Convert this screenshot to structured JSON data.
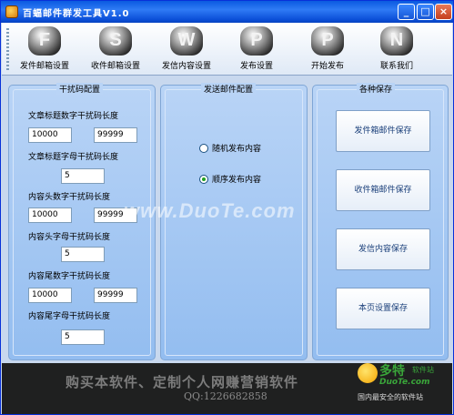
{
  "window": {
    "title": "百蝠邮件群发工具V1.0",
    "controls": {
      "minimize": "_",
      "maximize": "□",
      "close": "×"
    }
  },
  "toolbar": {
    "items": [
      {
        "label": "发件邮箱设置",
        "icon": "gear-f-icon",
        "glyph": "F"
      },
      {
        "label": "收件邮箱设置",
        "icon": "gear-s-icon",
        "glyph": "S"
      },
      {
        "label": "发信内容设置",
        "icon": "gear-w-icon",
        "glyph": "W"
      },
      {
        "label": "发布设置",
        "icon": "gear-p-icon",
        "glyph": "P"
      },
      {
        "label": "开始发布",
        "icon": "gear-p2-icon",
        "glyph": "P"
      },
      {
        "label": "联系我们",
        "icon": "gear-n-icon",
        "glyph": "N"
      }
    ]
  },
  "interference": {
    "legend": "干扰码配置",
    "article_title_num_label": "文章标题数字干扰码长度",
    "article_title_num_min": "10000",
    "article_title_num_max": "99999",
    "article_title_letter_label": "文章标题字母干扰码长度",
    "article_title_letter_value": "5",
    "content_head_num_label": "内容头数字干扰码长度",
    "content_head_num_min": "10000",
    "content_head_num_max": "99999",
    "content_head_letter_label": "内容头字母干扰码长度",
    "content_head_letter_value": "5",
    "content_tail_num_label": "内容尾数字干扰码长度",
    "content_tail_num_min": "10000",
    "content_tail_num_max": "99999",
    "content_tail_letter_label": "内容尾字母干扰码长度",
    "content_tail_letter_value": "5"
  },
  "send_config": {
    "legend": "发送邮件配置",
    "random_label": "随机发布内容",
    "sequential_label": "顺序发布内容",
    "selected": "sequential"
  },
  "saves": {
    "legend": "各种保存",
    "buttons": [
      "发件箱邮件保存",
      "收件箱邮件保存",
      "发信内容保存",
      "本页设置保存"
    ]
  },
  "banner": {
    "message": "购买本软件、定制个人网赚营销软件",
    "qq": "QQ:1226682858"
  },
  "watermark": {
    "text": "www.DuoTe.com"
  },
  "site_logo": {
    "name": "多特",
    "tag": "软件站",
    "domain": "DuoTe.com",
    "slogan": "国内最安全的软件站"
  }
}
